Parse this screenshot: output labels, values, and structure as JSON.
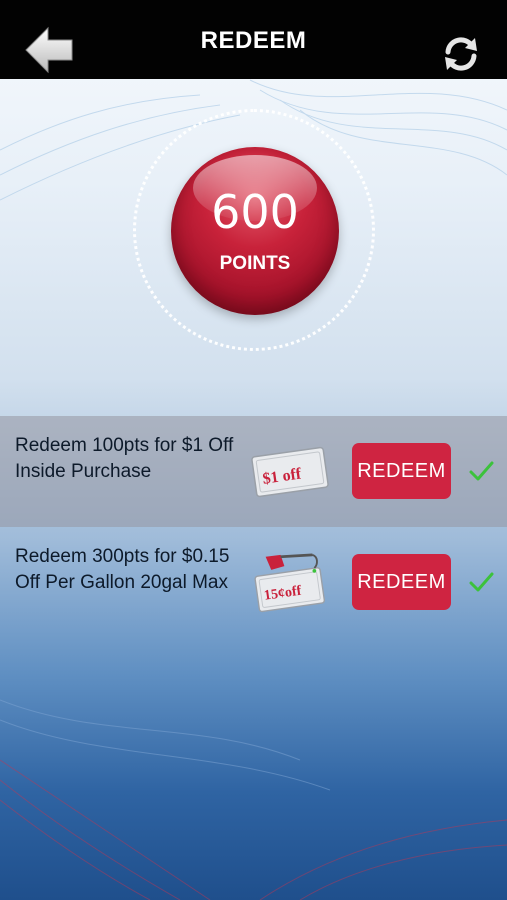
{
  "header": {
    "title": "REDEEM",
    "back_icon": "back-arrow-icon",
    "refresh_icon": "refresh-icon"
  },
  "points": {
    "value": "600",
    "label": "POINTS"
  },
  "offers": [
    {
      "description": "Redeem 100pts for $1 Off Inside Purchase",
      "button_label": "REDEEM",
      "coupon_icon": "dollar-off-coupon-icon",
      "coupon_text": "$1 off",
      "selected": true
    },
    {
      "description": "Redeem 300pts for $0.15 Off Per Gallon 20gal Max",
      "button_label": "REDEEM",
      "coupon_icon": "fuel-discount-coupon-icon",
      "coupon_text": "15¢off",
      "selected": false
    }
  ],
  "colors": {
    "header_bg": "#020202",
    "accent_red": "#cf2441",
    "check_green": "#3cc23c"
  }
}
